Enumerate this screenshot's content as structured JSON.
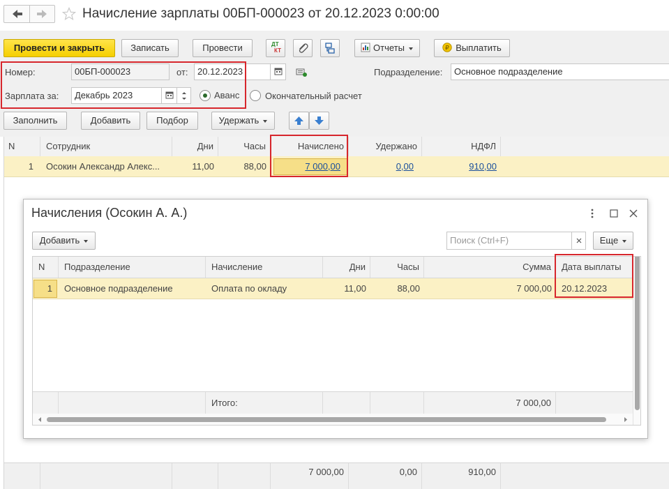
{
  "window": {
    "title": "Начисление зарплаты 00БП-000023 от 20.12.2023 0:00:00"
  },
  "toolbar": {
    "post_close": "Провести и закрыть",
    "save": "Записать",
    "post": "Провести",
    "dt_kt_top": "ДТ",
    "dt_kt_bottom": "КТ",
    "reports": "Отчеты",
    "pay": "Выплатить"
  },
  "form": {
    "number_label": "Номер:",
    "number_value": "00БП-000023",
    "date_label": "от:",
    "date_value": "20.12.2023",
    "division_label": "Подразделение:",
    "division_value": "Основное подразделение",
    "salary_for_label": "Зарплата за:",
    "salary_for_value": "Декабрь 2023",
    "radio_advance": "Аванс",
    "radio_final": "Окончательный расчет",
    "selected_radio": "advance"
  },
  "subtoolbar": {
    "fill": "Заполнить",
    "add": "Добавить",
    "select": "Подбор",
    "withhold": "Удержать"
  },
  "main_table": {
    "headers": {
      "n": "N",
      "employee": "Сотрудник",
      "days": "Дни",
      "hours": "Часы",
      "accrued": "Начислено",
      "withheld": "Удержано",
      "ndfl": "НДФЛ"
    },
    "rows": [
      {
        "n": "1",
        "employee": "Осокин Александр Алекс...",
        "days": "11,00",
        "hours": "88,00",
        "accrued": "7 000,00",
        "withheld": "0,00",
        "ndfl": "910,00"
      }
    ],
    "totals": {
      "accrued": "7 000,00",
      "withheld": "0,00",
      "ndfl": "910,00"
    }
  },
  "dialog": {
    "title": "Начисления (Осокин А. А.)",
    "add": "Добавить",
    "search_placeholder": "Поиск (Ctrl+F)",
    "more": "Еще",
    "headers": {
      "n": "N",
      "division": "Подразделение",
      "accrual": "Начисление",
      "days": "Дни",
      "hours": "Часы",
      "sum": "Сумма",
      "pay_date": "Дата выплаты"
    },
    "rows": [
      {
        "n": "1",
        "division": "Основное подразделение",
        "accrual": "Оплата по окладу",
        "days": "11,00",
        "hours": "88,00",
        "sum": "7 000,00",
        "pay_date": "20.12.2023"
      }
    ],
    "total_label": "Итого:",
    "total_sum": "7 000,00"
  },
  "colors": {
    "accent_yellow": "#f5cf00",
    "highlight_red": "#d7262c",
    "row_selected": "#fbf1c5",
    "link_blue": "#1a4f9c"
  }
}
